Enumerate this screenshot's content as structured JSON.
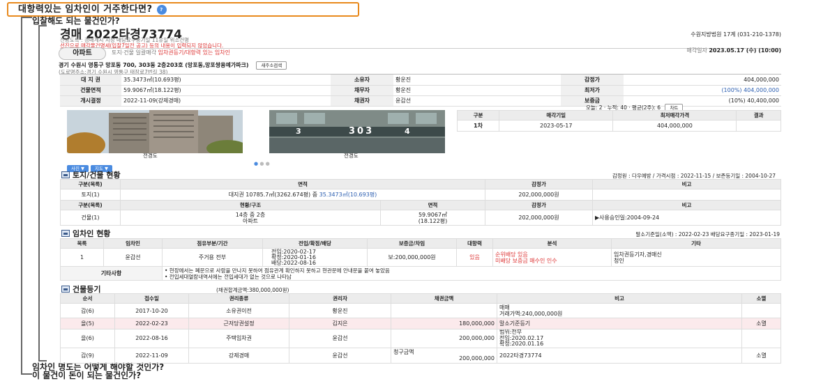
{
  "questions": {
    "q1": "대항력있는 임차인이 거주한다면?",
    "q1_badge": "?",
    "q2": "입찰해도 되는 물건인가?",
    "q3": "임차인 명도는 어떻게 해야할 것인가?",
    "q4": "이 물건이 돈이 되는 물건인가?"
  },
  "header": {
    "title": "경매 2022타경73774",
    "court": "수원지방법원 17계 (031-210-1378)",
    "meta_line": "전방도록 : 경매계시  지정  매당요구종기일  11유일  위소건명",
    "warning": "선진으로 매각물건명세(입찰7일전 공고) 등의 내용이 입력되지 않았습니다.",
    "type_pill": "아파트",
    "type_note_prefix": "토지·건물 일괄매각 ",
    "type_note_red": "임차권등기/대항력 있는 임차인",
    "sale_date_label": "매각일자 ",
    "sale_date": "2023.05.17 (수) (10:00)",
    "address": "경기 수원시 영통구 망포동 700, 303동 2층203호 (망포동,망포쌍용예가파크)",
    "address_btn": "새주소검색",
    "road_address": "(도로명주소:경기 수원시 영통구 태장로7번길 38)"
  },
  "summary": [
    {
      "l1": "대 지 권",
      "v1": "35.3473㎡(10.693평)",
      "l2": "소유자",
      "v2": "황운진",
      "l3": "감정가",
      "v3": "404,000,000"
    },
    {
      "l1": "건물면적",
      "v1": "59.9067㎡(18.122평)",
      "l2": "채무자",
      "v2": "황운진",
      "l3": "최저가",
      "v3": "(100%) 404,000,000"
    },
    {
      "l1": "개시결정",
      "v1": "2022-11-09(강제경매)",
      "l2": "채권자",
      "v2": "윤갑선",
      "l3": "보증금",
      "v3": "(10%) 40,400,000"
    }
  ],
  "views": {
    "text": "오늘: 2 · 누적: 40 · 평균(2주): 6",
    "btn": "차트"
  },
  "photos": {
    "cap1": "전경도",
    "cap2": "전경도",
    "sign_left": "3",
    "sign_center": "303",
    "sign_right": "4",
    "btn1": "사진 ▼",
    "btn2": "지도 ▼"
  },
  "bid_history": {
    "headers": [
      "구분",
      "매각기일",
      "최저매각가격",
      "결과"
    ],
    "rows": [
      [
        "1차",
        "2023-05-17",
        "404,000,000",
        ""
      ]
    ]
  },
  "land": {
    "title": "토지/건물 현황",
    "info": "감정원 : 다우예방 / 가격시점 : 2022-11-15 / 보존등기일 : 2004-10-27",
    "h1": [
      "구분(목록)",
      "면적",
      "감정가",
      "비고"
    ],
    "r1": {
      "a": "토지(1)",
      "b_pre": "대지권 10785.7㎡(3262.674평) 중 ",
      "b_blue": "35.3473㎡(10.693평)",
      "c": "202,000,000원",
      "d": ""
    },
    "h2": [
      "구분(목록)",
      "현황/구조",
      "면적",
      "감정가",
      "비고"
    ],
    "r2": {
      "a": "건물(1)",
      "b1": "14층 중 2층",
      "b2": "아파트",
      "c1": "59.9067㎡",
      "c2": "(18.122평)",
      "d": "202,000,000원",
      "e": "▶사용승인일:2004-09-24"
    }
  },
  "tenant": {
    "title": "임차인 현황",
    "info": "말소기준일(소액) : 2022-02-23   배당요구종기일 : 2023-01-19",
    "headers": [
      "목록",
      "임차인",
      "점유부분/기간",
      "전입/확정/배당",
      "보증금/차임",
      "대항력",
      "분석",
      "기타"
    ],
    "row": {
      "no": "1",
      "name": "윤갑선",
      "part": "주거용 전부",
      "d1": "전입:2020-02-17",
      "d2": "확정:2020-01-16",
      "d3": "배당:2022-08-16",
      "deposit": "보:200,000,000원",
      "daehang": "있음",
      "an1": "순위배당 있음",
      "an2": "미배당 보증금 매수인 인수",
      "etc1": "임차권등기자,경매신",
      "etc2": "청인"
    },
    "misc_label": "기타사항",
    "misc1": "• 현장에서는 폐문으로 사람을 만나지 못하여 점유관계 확인하지 못하고 현관문에 안내문을 붙여 놓았음",
    "misc2": "• 전입세대열람내역서에는 전입세대가 없는 것으로 나타남"
  },
  "registry": {
    "title": "건물등기",
    "sub": "(채권합계금액:380,000,000원)",
    "headers": [
      "순서",
      "접수일",
      "권리종류",
      "권리자",
      "채권금액",
      "비고",
      "소멸"
    ],
    "rows": [
      {
        "a": "갑(6)",
        "b": "2017-10-20",
        "c": "소유권이전",
        "d": "황운진",
        "e": "",
        "f1": "매매",
        "f2": "거래가액:240,000,000원",
        "g": ""
      },
      {
        "a": "을(5)",
        "b": "2022-02-23",
        "c": "근저당권설정",
        "d": "김지은",
        "e": "180,000,000",
        "f1": "말소기준등기",
        "f2": "",
        "g": "소멸"
      },
      {
        "a": "을(6)",
        "b": "2022-08-16",
        "c": "주택임차권",
        "d": "윤갑선",
        "e": "200,000,000",
        "f1": "범위:전부",
        "f2": "전입:2020.02.17",
        "f3": "확정:2020.01.16",
        "g": ""
      },
      {
        "a": "갑(9)",
        "b": "2022-11-09",
        "c": "강제경매",
        "d": "윤갑선",
        "e1": "청구금액",
        "e": "200,000,000",
        "f1": "2022타경73774",
        "f2": "",
        "g": "소멸"
      }
    ]
  }
}
